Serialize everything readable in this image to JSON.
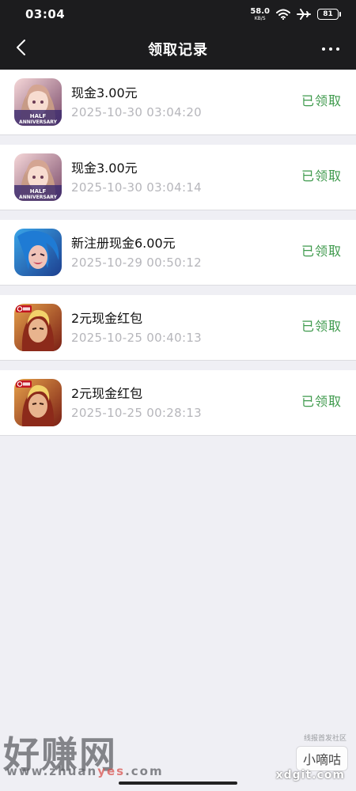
{
  "status_bar": {
    "time": "03:04",
    "net_speed": "58.0",
    "net_unit": "KB/S",
    "battery": "81",
    "icons": [
      "wifi-icon",
      "airplane-icon",
      "battery-icon"
    ]
  },
  "header": {
    "title": "领取记录",
    "back_icon": "chevron-left-icon",
    "more_icon": "more-dots-icon"
  },
  "records": [
    {
      "title": "现金3.00元",
      "time": "2025-10-30 03:04:20",
      "status": "已领取",
      "icon": "anime-girl-half-anniversary-app-icon"
    },
    {
      "title": "现金3.00元",
      "time": "2025-10-30 03:04:14",
      "status": "已领取",
      "icon": "anime-girl-half-anniversary-app-icon"
    },
    {
      "title": "新注册现金6.00元",
      "time": "2025-10-29 00:50:12",
      "status": "已领取",
      "icon": "blue-hair-character-app-icon"
    },
    {
      "title": "2元现金红包",
      "time": "2025-10-25 00:40:13",
      "status": "已领取",
      "icon": "hero-anniversary-app-icon"
    },
    {
      "title": "2元现金红包",
      "time": "2025-10-25 00:28:13",
      "status": "已领取",
      "icon": "hero-anniversary-app-icon"
    }
  ],
  "watermarks": {
    "left_logo": "好赚网",
    "left_url_a": "www.zhuan",
    "left_url_b": "yes",
    "left_url_c": ".com",
    "right_sub": "线报首发社区",
    "right_badge": "小嘀咕",
    "right_url": "xdgit.com"
  },
  "colors": {
    "header_bg": "#1c1c1e",
    "page_bg": "#efeff4",
    "status_green": "#3f9a4d",
    "time_gray": "#b6b6bb"
  }
}
